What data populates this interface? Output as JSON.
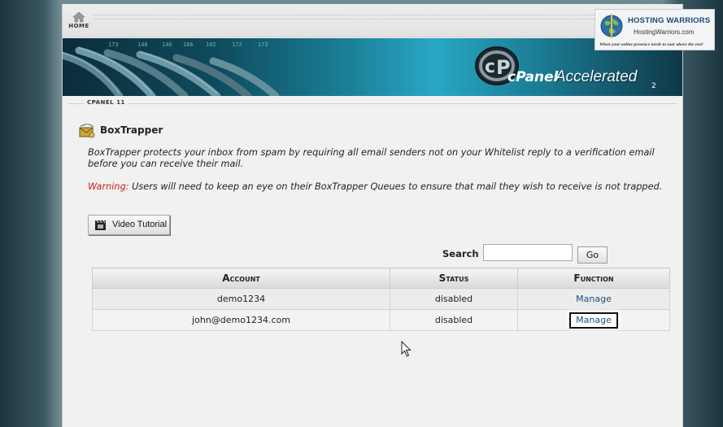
{
  "topbar": {
    "home_label": "HOME"
  },
  "banner": {
    "numbers": [
      "173",
      "148",
      "146",
      "166",
      "102",
      "172",
      "173"
    ],
    "cpanel_text": "cPanel",
    "accelerated_text": "Accelerated",
    "accelerated_sub": "2"
  },
  "breadcrumb": "CPANEL 11",
  "page": {
    "title": "BoxTrapper",
    "description": "BoxTrapper protects your inbox from spam by requiring all email senders not on your Whitelist reply to a verification email before you can receive their mail.",
    "warning_label": "Warning:",
    "warning_text": " Users will need to keep an eye on their BoxTrapper Queues to ensure that mail they wish to receive is not trapped.",
    "video_button": "Video Tutorial"
  },
  "search": {
    "label": "Search",
    "value": "",
    "go_label": "Go"
  },
  "table": {
    "headers": [
      "Account",
      "Status",
      "Function"
    ],
    "rows": [
      {
        "account": "demo1234",
        "status": "disabled",
        "function": "Manage"
      },
      {
        "account": "john@demo1234.com",
        "status": "disabled",
        "function": "Manage"
      }
    ]
  },
  "watermark": {
    "name": "HOSTING WARRIORS",
    "url": "HostingWarriors.com",
    "tagline": "When your online presence needs to soar above the rest!"
  },
  "colors": {
    "warning": "#cc2222",
    "link": "#1a4f7a",
    "banner_accent": "#28a7c4"
  }
}
